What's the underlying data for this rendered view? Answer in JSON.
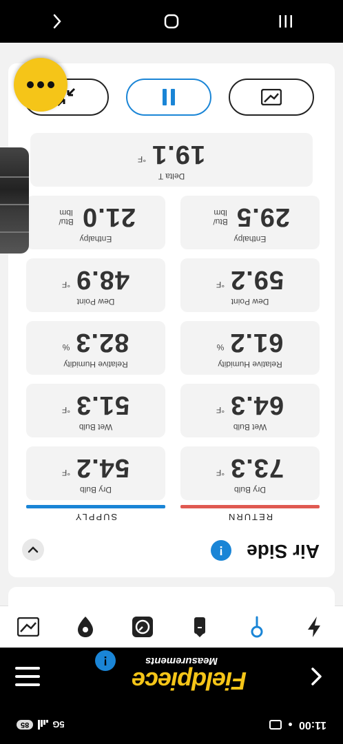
{
  "status_bar": {
    "time": "11:00",
    "network": "5G",
    "battery": "85"
  },
  "header": {
    "brand": "Fieldpiece",
    "subtitle": "Measurements",
    "help": "!"
  },
  "section": {
    "title": "Air Side",
    "help": "!"
  },
  "columns": {
    "return": "RETURN",
    "supply": "SUPPLY"
  },
  "return_metrics": [
    {
      "label": "Dry Bulb",
      "value": "73.3",
      "unit": "°F"
    },
    {
      "label": "Wet Bulb",
      "value": "64.3",
      "unit": "°F"
    },
    {
      "label": "Relative Humidity",
      "value": "61.2",
      "unit": "%"
    },
    {
      "label": "Dew Point",
      "value": "59.2",
      "unit": "°F"
    },
    {
      "label": "Enthalpy",
      "value": "29.5",
      "unit": "Btu/ lbm"
    }
  ],
  "supply_metrics": [
    {
      "label": "Dry Bulb",
      "value": "54.2",
      "unit": "°F"
    },
    {
      "label": "Wet Bulb",
      "value": "51.3",
      "unit": "°F"
    },
    {
      "label": "Relative Humidity",
      "value": "82.3",
      "unit": "%"
    },
    {
      "label": "Dew Point",
      "value": "48.9",
      "unit": "°F"
    },
    {
      "label": "Enthalpy",
      "value": "21.0",
      "unit": "Btu/ lbm"
    }
  ],
  "delta": {
    "label": "Delta T",
    "value": "19.1",
    "unit": "°F"
  },
  "colors": {
    "return_bar": "#e05a52",
    "supply_bar": "#1a85d6",
    "accent": "#f5c518"
  }
}
